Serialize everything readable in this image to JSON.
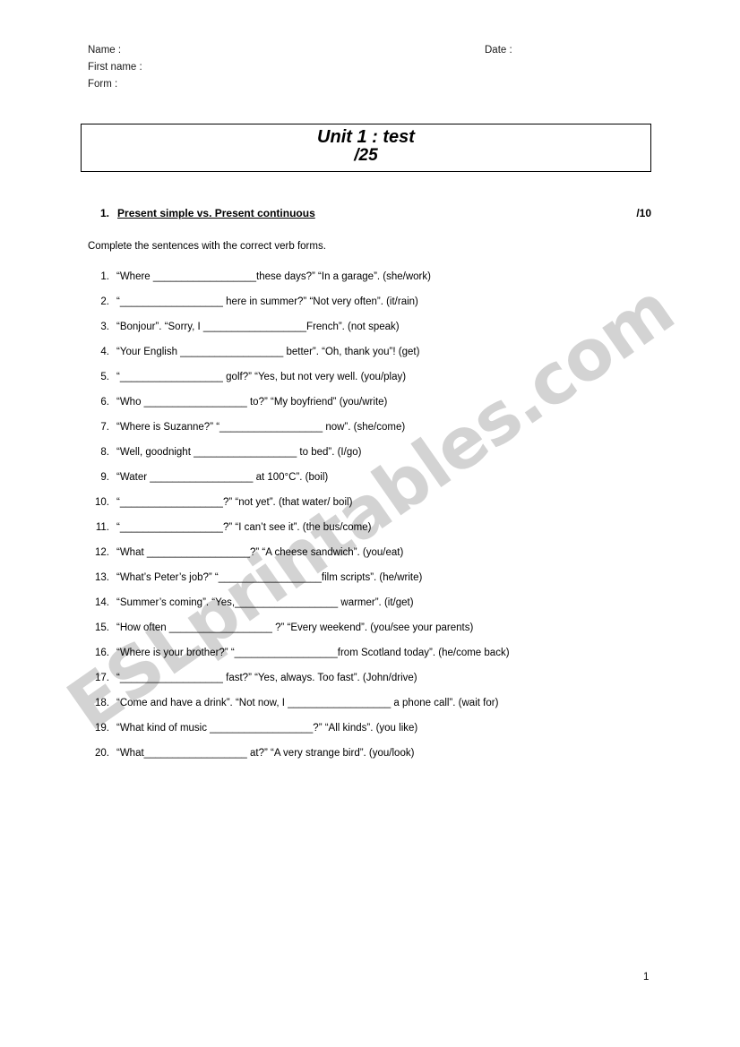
{
  "header": {
    "name_label": "Name :",
    "first_name_label": "First name :",
    "form_label": "Form :",
    "date_label": "Date :"
  },
  "title_box": {
    "line1": "Unit 1 : test",
    "line2": "/25"
  },
  "section": {
    "number": "1.",
    "title": "Present simple vs. Present continuous ",
    "points": "/10"
  },
  "instruction": "Complete the sentences with the correct verb forms.",
  "exercises": [
    {
      "num": "1.",
      "text": "“Where __________________these days?” “In a garage”. (she/work)"
    },
    {
      "num": "2.",
      "text": "“__________________ here in summer?” “Not very often”. (it/rain)"
    },
    {
      "num": "3.",
      "text": "“Bonjour”. “Sorry, I __________________French”. (not speak)"
    },
    {
      "num": "4.",
      "text": "“Your English __________________ better”. “Oh, thank you”! (get)"
    },
    {
      "num": "5.",
      "text": "“__________________ golf?” “Yes, but not very well. (you/play)"
    },
    {
      "num": "6.",
      "text": "“Who __________________ to?” “My boyfriend” (you/write)"
    },
    {
      "num": "7.",
      "text": "“Where is Suzanne?” “__________________ now”. (she/come)"
    },
    {
      "num": "8.",
      "text": "“Well, goodnight __________________ to bed”. (I/go)"
    },
    {
      "num": "9.",
      "text": "“Water __________________ at 100°C”. (boil)"
    },
    {
      "num": "10.",
      "text": "“__________________?” “not yet”. (that water/ boil)"
    },
    {
      "num": "11.",
      "text": "“__________________?” “I can’t see it”. (the bus/come)"
    },
    {
      "num": "12.",
      "text": "“What __________________?” “A cheese sandwich”. (you/eat)"
    },
    {
      "num": "13.",
      "text": "“What’s Peter’s job?” “__________________film scripts”. (he/write)"
    },
    {
      "num": "14.",
      "text": "“Summer’s coming”. “Yes,__________________ warmer”. (it/get)"
    },
    {
      "num": "15.",
      "text": "“How often __________________ ?” “Every weekend”. (you/see your parents)"
    },
    {
      "num": "16.",
      "text": "“Where is your brother?” “__________________from Scotland today”. (he/come back)"
    },
    {
      "num": "17.",
      "text": "“__________________ fast?”  “Yes, always. Too fast”. (John/drive)"
    },
    {
      "num": "18.",
      "text": "“Come and have a drink”. “Not now, I __________________ a phone call”. (wait for)"
    },
    {
      "num": "19.",
      "text": "“What kind of music __________________?” “All kinds”. (you like)"
    },
    {
      "num": "20.",
      "text": "“What__________________ at?” “A very strange bird”. (you/look)"
    }
  ],
  "watermark": {
    "text": "ESLprintables.com",
    "color": "#d3d3d3"
  },
  "page_number": "1"
}
